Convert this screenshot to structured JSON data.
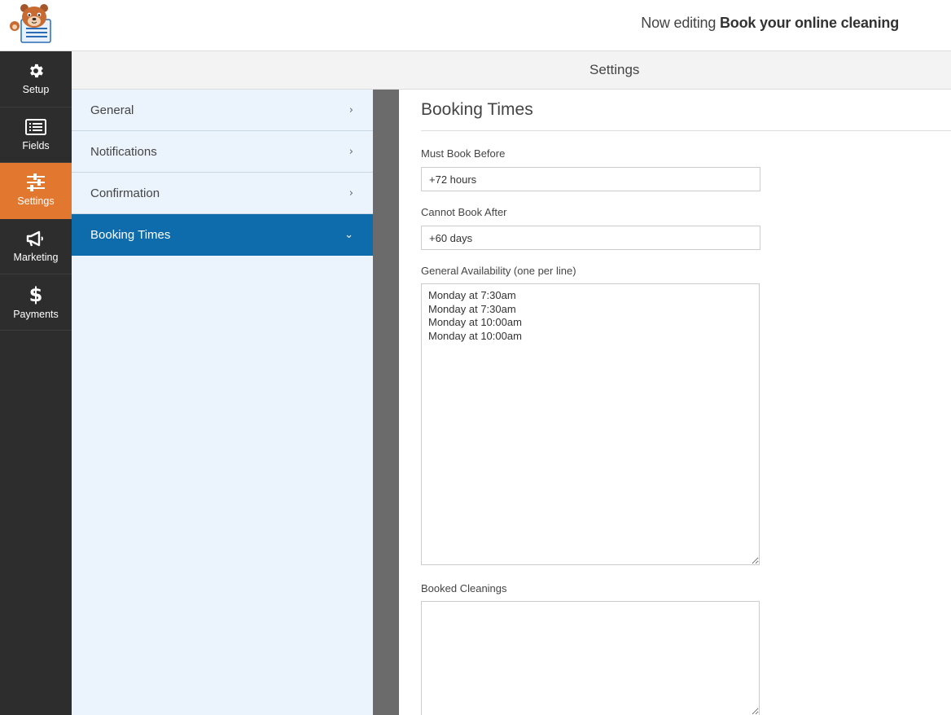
{
  "header": {
    "now_editing_prefix": "Now editing",
    "form_name": "Book your online cleaning"
  },
  "leftnav": {
    "items": [
      {
        "label": "Setup",
        "icon": "gear-icon"
      },
      {
        "label": "Fields",
        "icon": "list-icon"
      },
      {
        "label": "Settings",
        "icon": "sliders-icon",
        "active": true
      },
      {
        "label": "Marketing",
        "icon": "megaphone-icon"
      },
      {
        "label": "Payments",
        "icon": "dollar-icon"
      }
    ]
  },
  "panel": {
    "title": "Settings"
  },
  "sections": {
    "items": [
      {
        "label": "General",
        "chevron": "›"
      },
      {
        "label": "Notifications",
        "chevron": "›"
      },
      {
        "label": "Confirmation",
        "chevron": "›"
      },
      {
        "label": "Booking Times",
        "chevron": "⌄",
        "active": true
      }
    ]
  },
  "booking": {
    "title": "Booking Times",
    "must_book_before": {
      "label": "Must Book Before",
      "value": "+72 hours"
    },
    "cannot_book_after": {
      "label": "Cannot Book After",
      "value": "+60 days"
    },
    "general_availability": {
      "label": "General Availability (one per line)",
      "value": "Monday at 7:30am\nMonday at 7:30am\nMonday at 10:00am\nMonday at 10:00am"
    },
    "booked_cleanings": {
      "label": "Booked Cleanings",
      "value": ""
    }
  },
  "colors": {
    "nav_bg": "#2d2d2d",
    "nav_active": "#e27730",
    "section_active": "#0e6cad",
    "section_bg": "#ebf3fc"
  }
}
